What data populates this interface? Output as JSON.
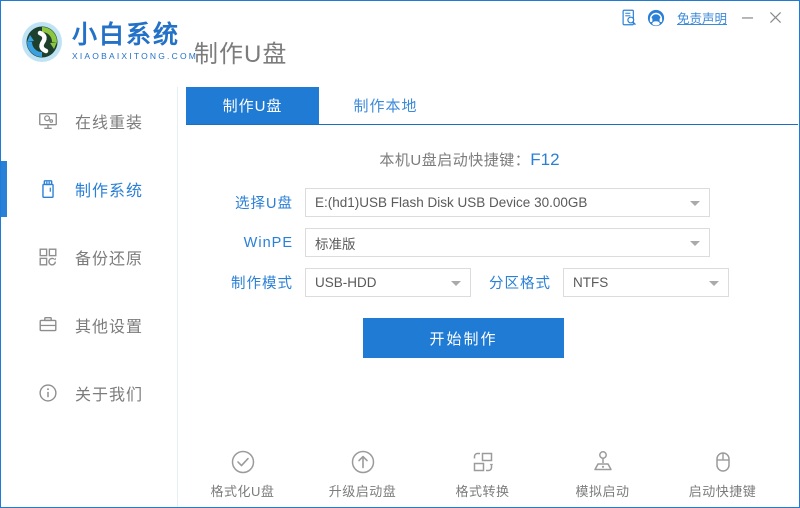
{
  "window": {
    "app_name_cn": "小白系统",
    "app_name_en": "XIAOBAIXITONG.COM",
    "page_title": "制作U盘",
    "disclaimer": "免责声明",
    "minimize": "—",
    "close": "✕",
    "accent_color": "#1f7bd4",
    "link_color": "#2a80d6",
    "text_color": "#7c7c7c"
  },
  "titlebar_icons": [
    {
      "name": "document-search-icon"
    },
    {
      "name": "customer-service-icon"
    }
  ],
  "sidebar": {
    "items": [
      {
        "label": "在线重装",
        "icon": "monitor-icon",
        "active": false
      },
      {
        "label": "制作系统",
        "icon": "usb-drive-icon",
        "active": true
      },
      {
        "label": "备份还原",
        "icon": "grid-refresh-icon",
        "active": false
      },
      {
        "label": "其他设置",
        "icon": "toolbox-icon",
        "active": false
      },
      {
        "label": "关于我们",
        "icon": "info-circle-icon",
        "active": false
      }
    ]
  },
  "main": {
    "tabs": [
      {
        "label": "制作U盘",
        "active": true
      },
      {
        "label": "制作本地",
        "active": false
      }
    ],
    "hint_text": "本机U盘启动快捷键：",
    "hint_key": "F12",
    "fields": {
      "usb_label": "选择U盘",
      "usb_value": "E:(hd1)USB Flash Disk USB Device 30.00GB",
      "winpe_label": "WinPE",
      "winpe_value": "标准版",
      "mode_label": "制作模式",
      "mode_value": "USB-HDD",
      "partition_label": "分区格式",
      "partition_value": "NTFS"
    },
    "start_button": "开始制作",
    "tools": [
      {
        "label": "格式化U盘",
        "icon": "check-circle-icon"
      },
      {
        "label": "升级启动盘",
        "icon": "arrow-up-circle-icon"
      },
      {
        "label": "格式转换",
        "icon": "format-convert-icon"
      },
      {
        "label": "模拟启动",
        "icon": "joystick-icon"
      },
      {
        "label": "启动快捷键",
        "icon": "mouse-icon"
      }
    ]
  }
}
